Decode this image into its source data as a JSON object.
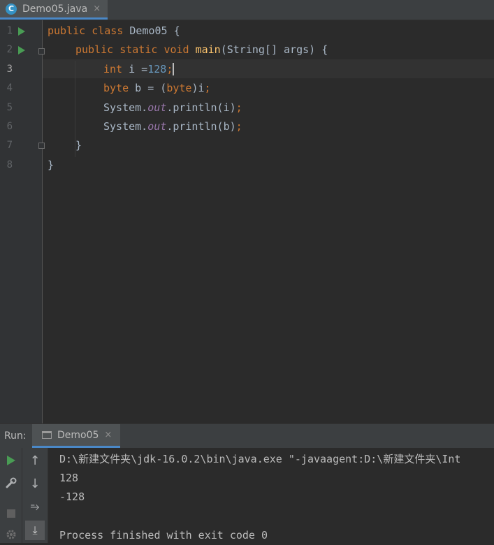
{
  "editor_tab": {
    "icon_letter": "C",
    "label": "Demo05.java",
    "close": "×"
  },
  "line_numbers": [
    "1",
    "2",
    "3",
    "4",
    "5",
    "6",
    "7",
    "8"
  ],
  "code": {
    "l1": {
      "kw1": "public",
      "kw2": "class",
      "name": " Demo05 {"
    },
    "l2": {
      "kw1": "public",
      "kw2": "static",
      "kw3": "void",
      "fn": "main",
      "rest": "(String[] args) {"
    },
    "l3": {
      "kw": "int",
      "rest": " i =",
      "num": "128",
      "semi": ";"
    },
    "l4": {
      "kw1": "byte",
      "mid": " b = (",
      "kw2": "byte",
      "rest": ")i",
      "semi": ";"
    },
    "l5": {
      "pre": "System.",
      "field": "out",
      "rest": ".println(i)",
      "semi": ";"
    },
    "l6": {
      "pre": "System.",
      "field": "out",
      "rest": ".println(b)",
      "semi": ";"
    },
    "l7": "}",
    "l8": "}"
  },
  "run_panel": {
    "label": "Run:",
    "tab_label": "Demo05",
    "tab_close": "×",
    "icons": {
      "rerun": "play-icon",
      "settings": "wrench-icon",
      "stop": "stop-icon",
      "up": "↑",
      "down": "↓",
      "wrap": "⥱",
      "scroll_end": "⤓"
    }
  },
  "console": {
    "lines": [
      "D:\\新建文件夹\\jdk-16.0.2\\bin\\java.exe \"-javaagent:D:\\新建文件夹\\Int",
      "128",
      "-128",
      "",
      "Process finished with exit code 0"
    ]
  },
  "colors": {
    "keyword": "#cc7832",
    "function": "#ffc66d",
    "number": "#6897bb",
    "field": "#9876aa",
    "text": "#a9b7c6",
    "run_green": "#499c54",
    "accent": "#4a88c7"
  }
}
